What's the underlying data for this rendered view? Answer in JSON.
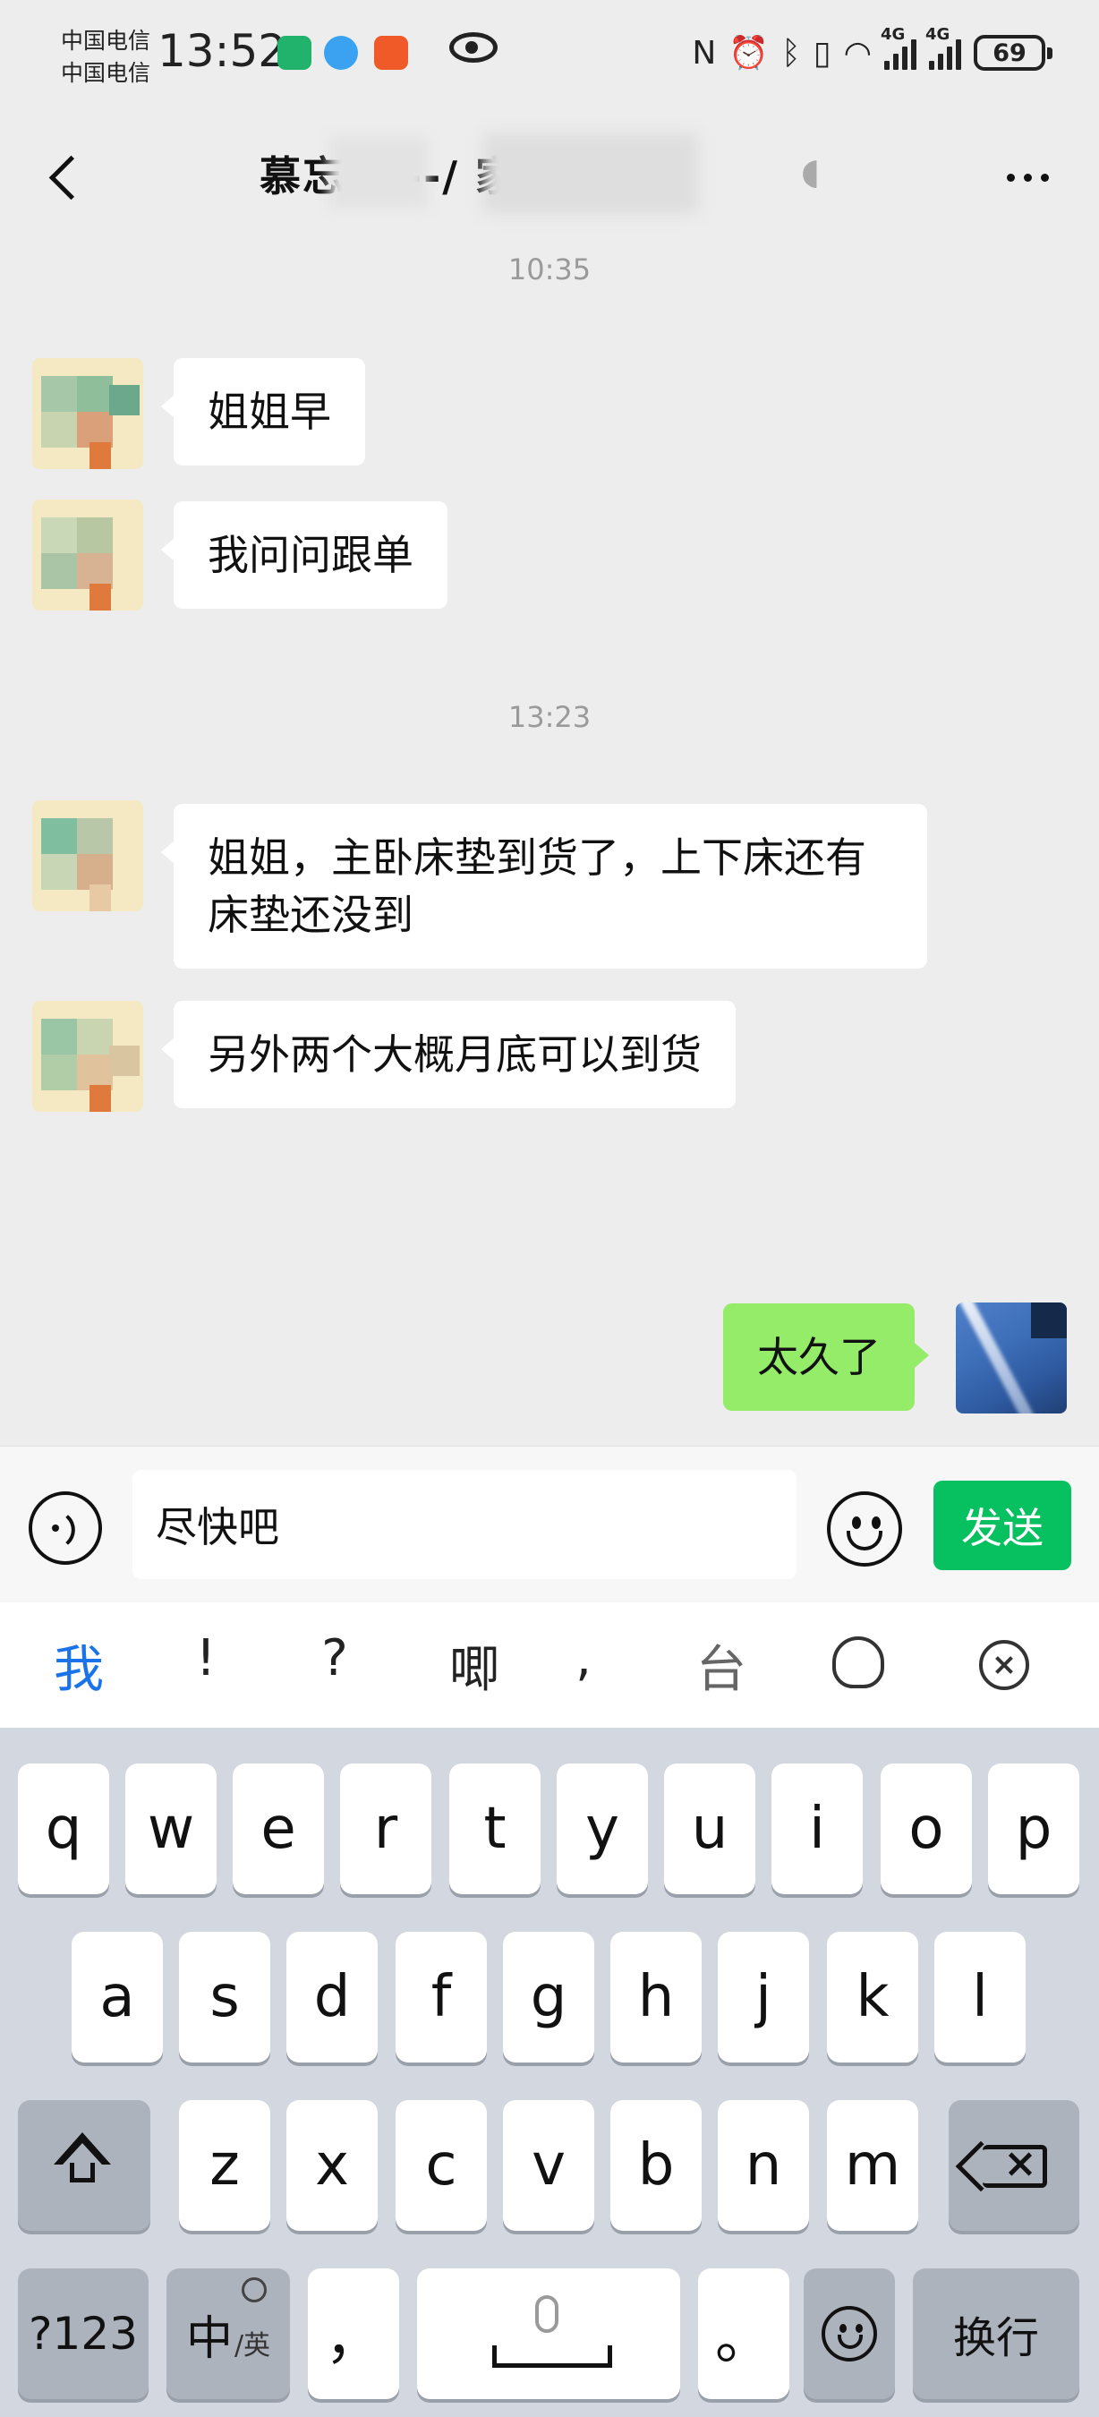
{
  "status_bar": {
    "carrier_1": "中国电信",
    "carrier_2": "中国电信",
    "time": "13:52",
    "network_1": "4G",
    "network_2": "4G",
    "battery": "69",
    "icons": [
      "hourglass-icon",
      "browser-icon",
      "app-icon",
      "eye-icon",
      "nfc-icon",
      "alarm-icon",
      "bluetooth-icon",
      "vibrate-icon",
      "wifi-icon",
      "signal-icon",
      "battery-icon"
    ]
  },
  "header": {
    "title": "慕忘 婷--/   家 溪",
    "back_icon": "chevron-left-icon",
    "ear_icon": "ear-icon",
    "more_icon": "more-icon"
  },
  "messages": {
    "timestamp_1": "10:35",
    "m1": "姐姐早",
    "m2": "我问问跟单",
    "timestamp_2": "13:23",
    "m3": "姐姐，主卧床垫到货了，上下床还有床垫还没到",
    "m4": "另外两个大概月底可以到货",
    "m5": "太久了"
  },
  "input_bar": {
    "voice_icon": "voice-icon",
    "text": "尽快吧",
    "emoji_icon": "emoji-icon",
    "send_label": "发送"
  },
  "candidates": {
    "items": [
      "我",
      "!",
      "?",
      "唧",
      ","
    ],
    "icons": [
      "keyboard-switch-icon",
      "handwriting-icon",
      "close-icon"
    ],
    "switch_label": "台"
  },
  "keyboard": {
    "row1": [
      "q",
      "w",
      "e",
      "r",
      "t",
      "y",
      "u",
      "i",
      "o",
      "p"
    ],
    "row2": [
      "a",
      "s",
      "d",
      "f",
      "g",
      "h",
      "j",
      "k",
      "l"
    ],
    "row3": [
      "z",
      "x",
      "c",
      "v",
      "b",
      "n",
      "m"
    ],
    "symbols_label": "?123",
    "lang_label": "中",
    "lang_sub": "/英",
    "comma": "，",
    "period": "。",
    "enter_label": "换行"
  },
  "colors": {
    "send_green": "#07c160",
    "outgoing_bubble": "#95ec69",
    "chat_background": "#ededed",
    "keyboard_background": "#d3d7df",
    "candidate_highlight": "#1a73e8"
  }
}
